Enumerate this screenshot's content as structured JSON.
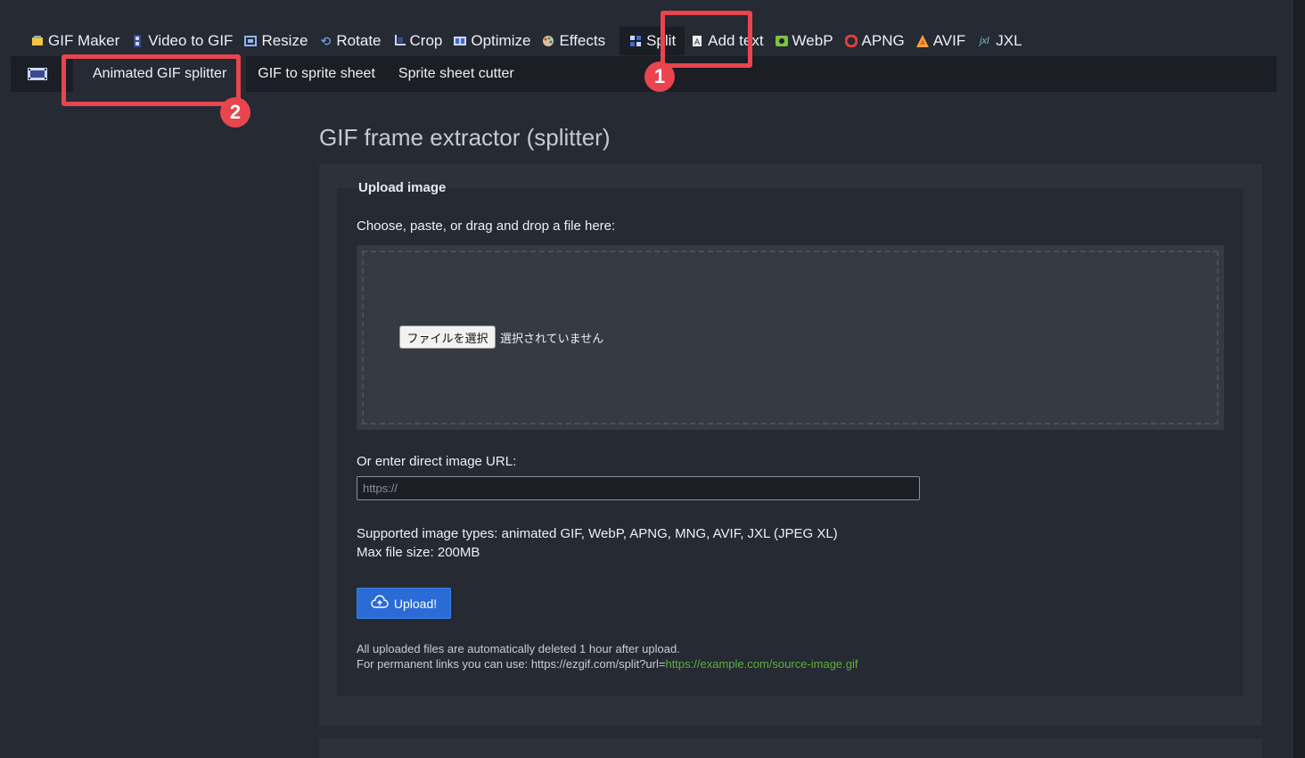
{
  "topnav": {
    "items": [
      {
        "label": "GIF Maker",
        "icon": "gif-maker-icon"
      },
      {
        "label": "Video to GIF",
        "icon": "video-icon"
      },
      {
        "label": "Resize",
        "icon": "resize-icon"
      },
      {
        "label": "Rotate",
        "icon": "rotate-icon"
      },
      {
        "label": "Crop",
        "icon": "crop-icon"
      },
      {
        "label": "Optimize",
        "icon": "optimize-icon"
      },
      {
        "label": "Effects",
        "icon": "palette-icon"
      },
      {
        "label": "Split",
        "icon": "split-icon"
      },
      {
        "label": "Add text",
        "icon": "add-text-icon"
      },
      {
        "label": "WebP",
        "icon": "webp-icon"
      },
      {
        "label": "APNG",
        "icon": "apng-icon"
      },
      {
        "label": "AVIF",
        "icon": "avif-icon"
      },
      {
        "label": "JXL",
        "icon": "jxl-icon"
      }
    ],
    "active": "Split"
  },
  "subnav": {
    "items": [
      {
        "label": "Animated GIF splitter"
      },
      {
        "label": "GIF to sprite sheet"
      },
      {
        "label": "Sprite sheet cutter"
      }
    ],
    "active": "Animated GIF splitter"
  },
  "annotations": {
    "step1": "1",
    "step2": "2",
    "color": "#e8454f"
  },
  "page": {
    "title": "GIF frame extractor (splitter)"
  },
  "upload_form": {
    "legend": "Upload image",
    "choose_label": "Choose, paste, or drag and drop a file here:",
    "file_button": "ファイルを選択",
    "file_status": "選択されていません",
    "url_label": "Or enter direct image URL:",
    "url_placeholder": "https://",
    "url_value": "",
    "supported": "Supported image types: animated GIF, WebP, APNG, MNG, AVIF, JXL (JPEG XL)",
    "max_size": "Max file size: 200MB",
    "upload_button": "Upload!",
    "note_delete": "All uploaded files are automatically deleted 1 hour after upload.",
    "note_permanent_prefix": "For permanent links you can use: https://ezgif.com/split?url=",
    "note_permanent_link": "https://example.com/source-image.gif"
  },
  "colors": {
    "accent": "#2a6bd6",
    "link": "#5fae3a",
    "background": "#252a33",
    "nav_dark": "#1b1e24"
  }
}
